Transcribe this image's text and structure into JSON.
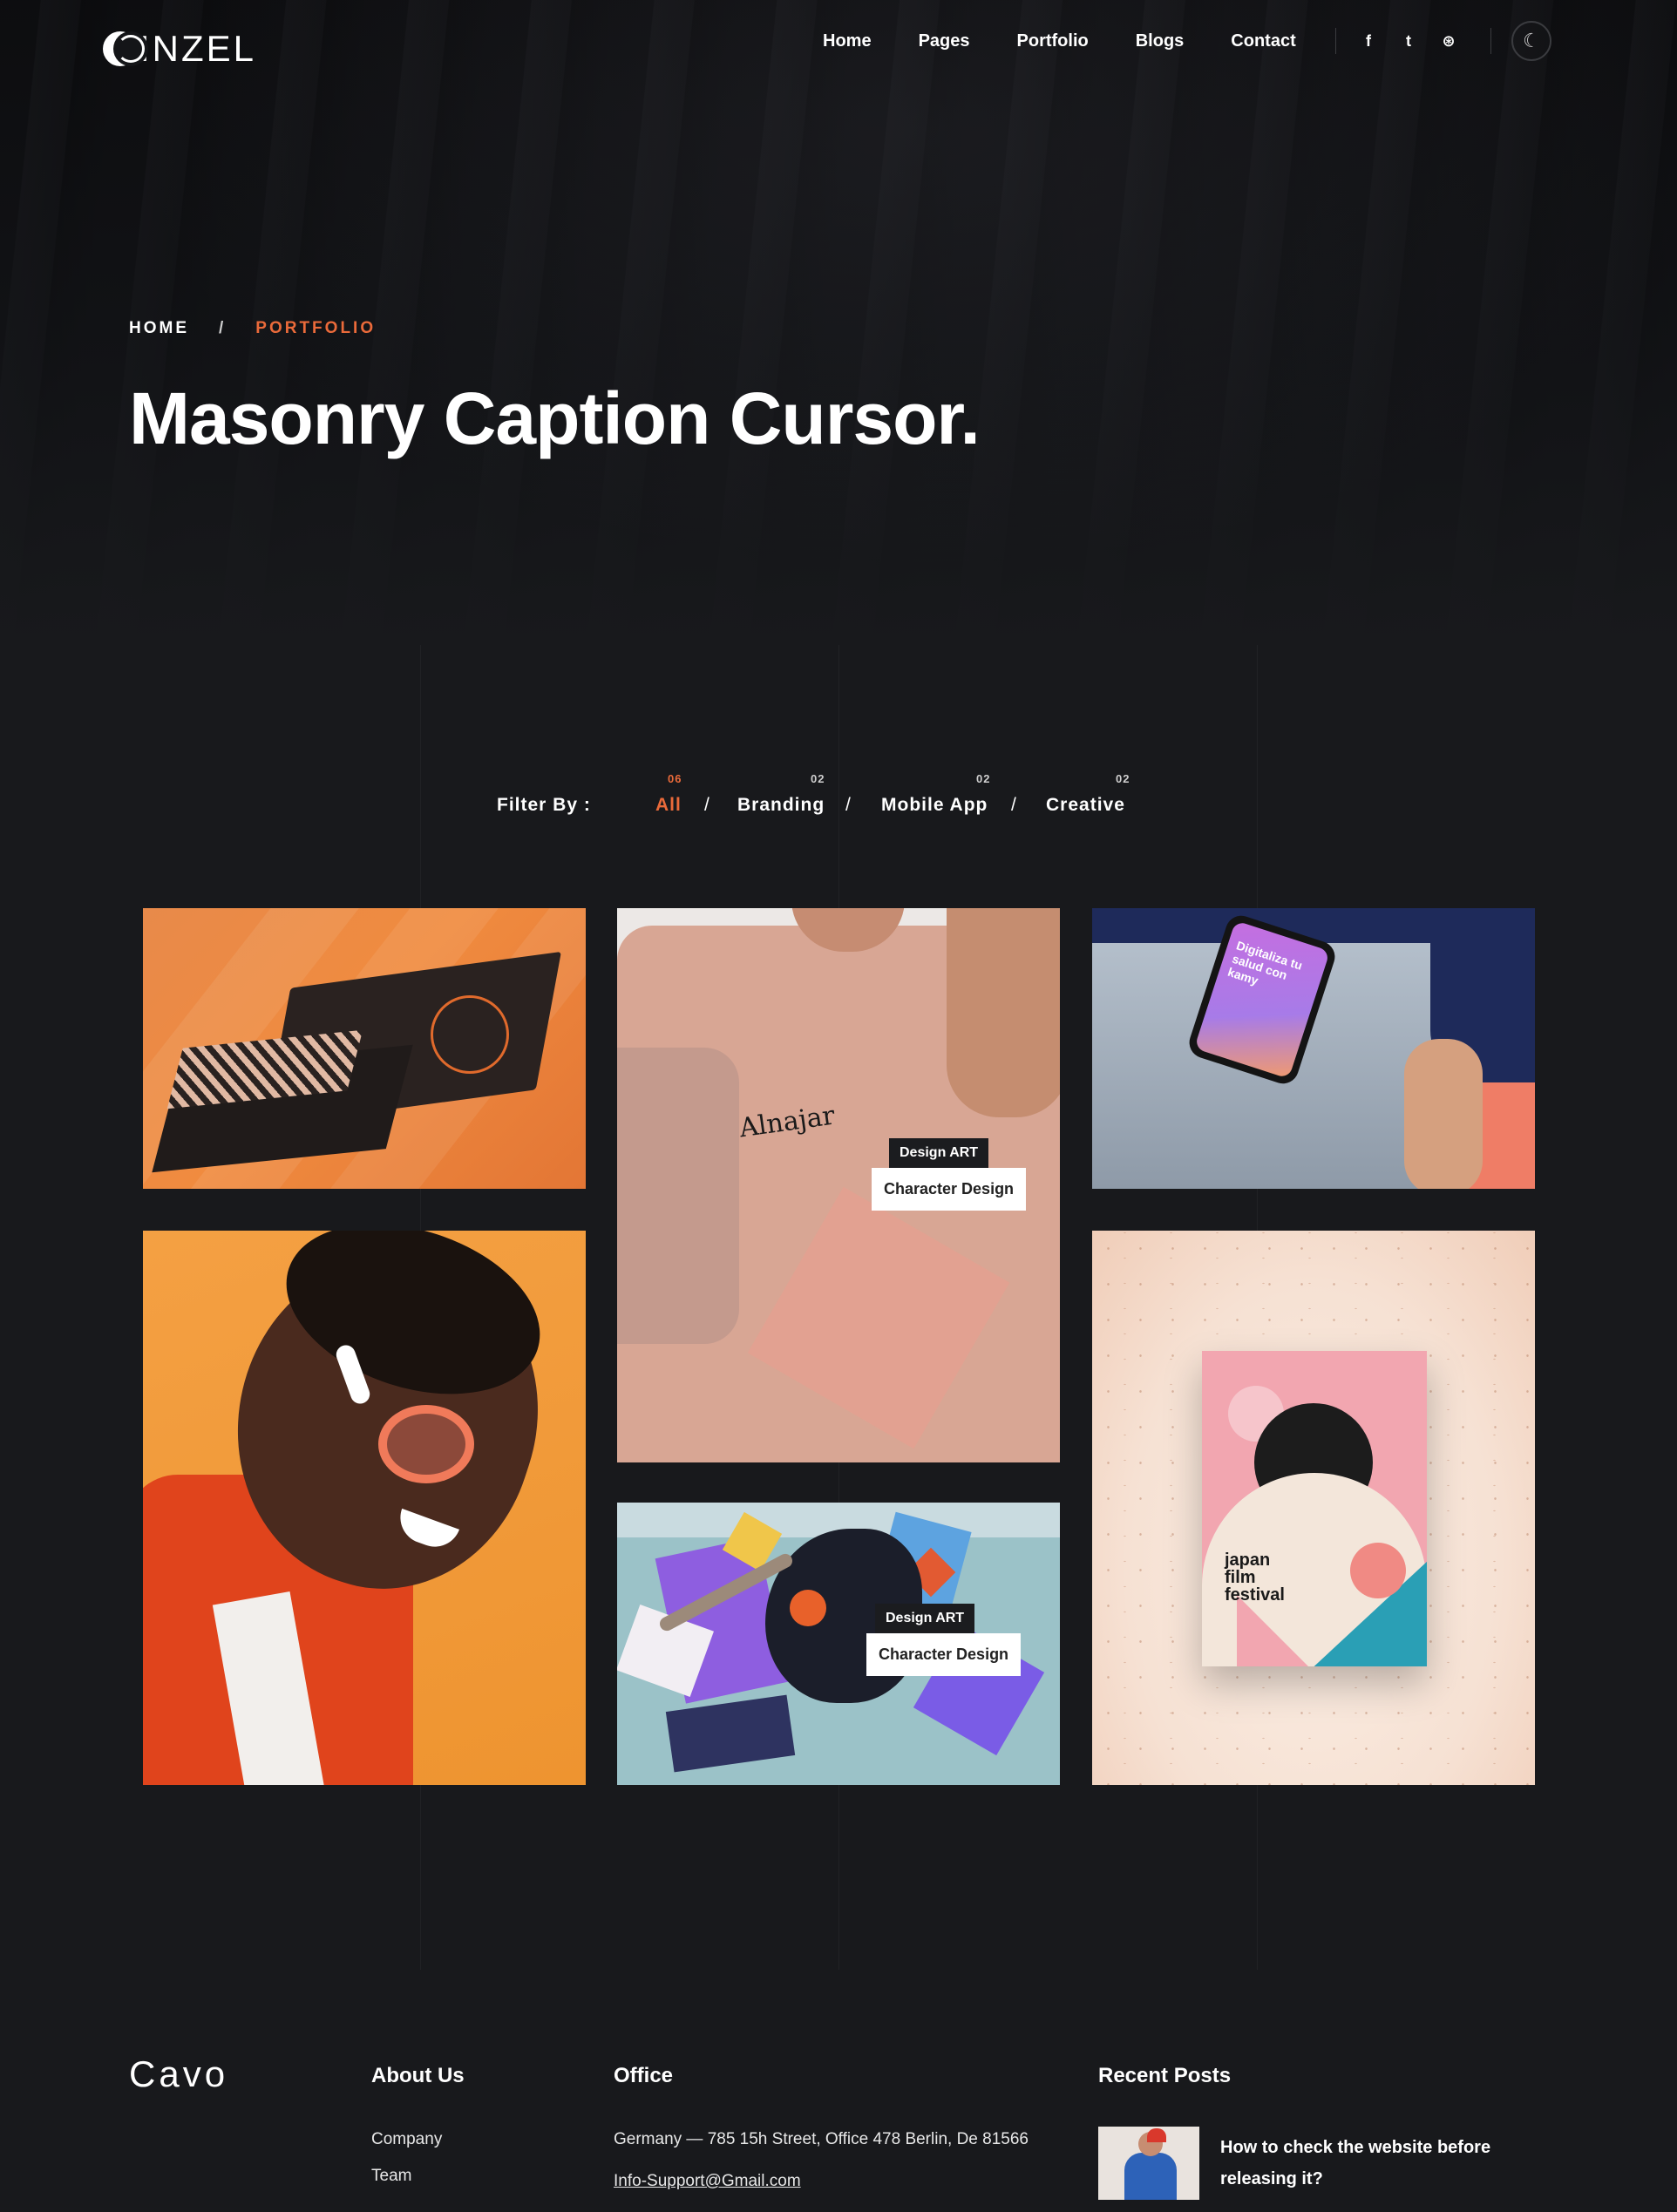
{
  "brand": {
    "logo_text": "INZEL"
  },
  "nav": {
    "items": [
      "Home",
      "Pages",
      "Portfolio",
      "Blogs",
      "Contact"
    ],
    "social_icons": [
      "facebook-icon",
      "twitter-icon",
      "dribbble-icon"
    ],
    "social_glyphs": [
      "f",
      "t",
      "⊛"
    ],
    "dark_mode_icon": "moon-icon"
  },
  "breadcrumb": {
    "home": "HOME",
    "separator": "/",
    "current": "PORTFOLIO"
  },
  "page_title": "Masonry Caption Cursor.",
  "filter": {
    "label": "Filter By :",
    "items": [
      {
        "label": "All",
        "count": "06",
        "active": true
      },
      {
        "label": "Branding",
        "count": "02",
        "active": false
      },
      {
        "label": "Mobile App",
        "count": "02",
        "active": false
      },
      {
        "label": "Creative",
        "count": "02",
        "active": false
      }
    ],
    "separator": "/"
  },
  "portfolio": {
    "items": [
      {
        "name": "envelope-mockup"
      },
      {
        "name": "tshirt-mockup",
        "brand_text": "Alnajar",
        "caption_tag": "Design ART",
        "caption_title": "Character Design"
      },
      {
        "name": "phone-in-pocket",
        "screen_text": "Digitaliza tu salud con kamy"
      },
      {
        "name": "portrait-with-glasses"
      },
      {
        "name": "graffiti-bird",
        "caption_tag": "Design ART",
        "caption_title": "Character Design"
      },
      {
        "name": "film-festival-poster",
        "poster_text": "japan film festival"
      }
    ]
  },
  "colors": {
    "accent": "#ea6a3a",
    "background": "#18191c"
  },
  "footer": {
    "logo": "Cavo",
    "about": {
      "heading": "About Us",
      "links": [
        "Company",
        "Team"
      ]
    },
    "office": {
      "heading": "Office",
      "address": "Germany — 785 15h Street, Office 478 Berlin, De 81566",
      "email": "Info-Support@Gmail.com"
    },
    "recent_posts": {
      "heading": "Recent Posts",
      "posts": [
        {
          "title": "How to check the website before releasing it?"
        }
      ]
    }
  }
}
